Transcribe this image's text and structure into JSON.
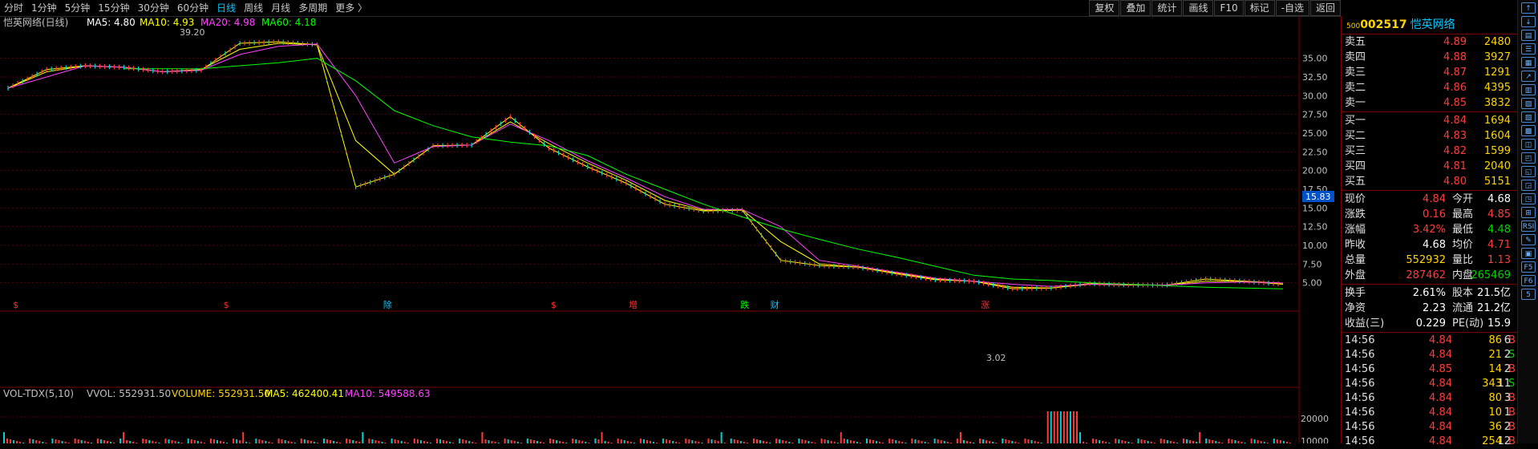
{
  "period_bar": {
    "items": [
      "分时",
      "1分钟",
      "5分钟",
      "15分钟",
      "30分钟",
      "60分钟",
      "日线",
      "周线",
      "月线",
      "多周期",
      "更多 〉"
    ],
    "active_index": 6
  },
  "toolbar": {
    "buttons": [
      "复权",
      "叠加",
      "统计",
      "画线",
      "F10",
      "标记",
      "-自选",
      "返回"
    ]
  },
  "main_legend": {
    "title": "恺英网络(日线)",
    "ma5": "MA5: 4.80",
    "ma10": "MA10: 4.93",
    "ma20": "MA20: 4.98",
    "ma60": "MA60: 4.18"
  },
  "main_axis": {
    "ticks": [
      "35.00",
      "32.50",
      "30.00",
      "27.50",
      "25.00",
      "22.50",
      "20.00",
      "17.50",
      "15.00",
      "12.50",
      "10.00",
      "7.50",
      "5.00"
    ],
    "tick_values": [
      35,
      32.5,
      30,
      27.5,
      25,
      22.5,
      20,
      17.5,
      15,
      12.5,
      10,
      7.5,
      5
    ],
    "crosshair_value": "15.83",
    "high_marker": "39.20",
    "low_marker": "3.02"
  },
  "event_markers": [
    {
      "label": "$",
      "color": "#ff3030",
      "pos": 0.01
    },
    {
      "label": "$",
      "color": "#ff3030",
      "pos": 0.172
    },
    {
      "label": "除",
      "color": "#00c8ff",
      "pos": 0.295
    },
    {
      "label": "$",
      "color": "#ff3030",
      "pos": 0.424
    },
    {
      "label": "增",
      "color": "#ff3030",
      "pos": 0.484
    },
    {
      "label": "跌",
      "color": "#00ff00",
      "pos": 0.57
    },
    {
      "label": "财",
      "color": "#00c8ff",
      "pos": 0.593
    },
    {
      "label": "涨",
      "color": "#ff3030",
      "pos": 0.755
    }
  ],
  "volume_legend": {
    "title": "VOL-TDX(5,10)",
    "vvol": "VVOL: 552931.50",
    "volume": "VOLUME: 552931.50",
    "ma5": "MA5: 462400.41",
    "ma10": "MA10: 549588.63"
  },
  "volume_axis": {
    "ticks": [
      "20000",
      "10000"
    ]
  },
  "quote": {
    "code": "002517",
    "name": "恺英网络",
    "code_prefix": "500",
    "asks": [
      {
        "label": "卖五",
        "price": "4.89",
        "vol": "2480"
      },
      {
        "label": "卖四",
        "price": "4.88",
        "vol": "3927"
      },
      {
        "label": "卖三",
        "price": "4.87",
        "vol": "1291"
      },
      {
        "label": "卖二",
        "price": "4.86",
        "vol": "4395"
      },
      {
        "label": "卖一",
        "price": "4.85",
        "vol": "3832"
      }
    ],
    "bids": [
      {
        "label": "买一",
        "price": "4.84",
        "vol": "1694"
      },
      {
        "label": "买二",
        "price": "4.83",
        "vol": "1604"
      },
      {
        "label": "买三",
        "price": "4.82",
        "vol": "1599"
      },
      {
        "label": "买四",
        "price": "4.81",
        "vol": "2040"
      },
      {
        "label": "买五",
        "price": "4.80",
        "vol": "5151"
      }
    ],
    "stats": [
      {
        "l1": "现价",
        "v1": "4.84",
        "c1": "red",
        "l2": "今开",
        "v2": "4.68",
        "c2": "white"
      },
      {
        "l1": "涨跌",
        "v1": "0.16",
        "c1": "red",
        "l2": "最高",
        "v2": "4.85",
        "c2": "red"
      },
      {
        "l1": "涨幅",
        "v1": "3.42%",
        "c1": "red",
        "l2": "最低",
        "v2": "4.48",
        "c2": "green"
      },
      {
        "l1": "昨收",
        "v1": "4.68",
        "c1": "white",
        "l2": "均价",
        "v2": "4.71",
        "c2": "red"
      },
      {
        "l1": "总量",
        "v1": "552932",
        "c1": "yellow",
        "l2": "量比",
        "v2": "1.13",
        "c2": "red"
      },
      {
        "l1": "外盘",
        "v1": "287462",
        "c1": "red",
        "l2": "内盘",
        "v2": "265469",
        "c2": "green"
      }
    ],
    "stats2": [
      {
        "l1": "换手",
        "v1": "2.61%",
        "c1": "white",
        "l2": "股本",
        "v2": "21.5亿",
        "c2": "white"
      },
      {
        "l1": "净资",
        "v1": "2.23",
        "c1": "white",
        "l2": "流通",
        "v2": "21.2亿",
        "c2": "white"
      },
      {
        "l1": "收益(三)",
        "v1": "0.229",
        "c1": "white",
        "l2": "PE(动)",
        "v2": "15.9",
        "c2": "white"
      }
    ],
    "ticks": [
      {
        "time": "14:56",
        "price": "4.84",
        "vol": "86",
        "bs": "B",
        "n": "6"
      },
      {
        "time": "14:56",
        "price": "4.84",
        "vol": "21",
        "bs": "S",
        "n": "2"
      },
      {
        "time": "14:56",
        "price": "4.85",
        "vol": "14",
        "bs": "B",
        "n": "2"
      },
      {
        "time": "14:56",
        "price": "4.84",
        "vol": "343",
        "bs": "S",
        "n": "11"
      },
      {
        "time": "14:56",
        "price": "4.84",
        "vol": "80",
        "bs": "B",
        "n": "3"
      },
      {
        "time": "14:56",
        "price": "4.84",
        "vol": "10",
        "bs": "B",
        "n": "1"
      },
      {
        "time": "14:56",
        "price": "4.84",
        "vol": "36",
        "bs": "B",
        "n": "2"
      },
      {
        "time": "14:56",
        "price": "4.84",
        "vol": "254",
        "bs": "B",
        "n": "12"
      }
    ]
  },
  "side_icons": [
    "↑",
    "↓",
    "▤",
    "☰",
    "▦",
    "↗",
    "▥",
    "▧",
    "▨",
    "▩",
    "◫",
    "◰",
    "◱",
    "◲",
    "◳",
    "⊞",
    "RSI",
    "✎",
    "▣",
    "F5",
    "F6",
    "5"
  ],
  "colors": {
    "up": "#ff3b3b",
    "down": "#00d2d2",
    "ma5": "#ffff00",
    "ma10": "#ff40ff",
    "ma20": "#00ff00",
    "grid": "#7a0000"
  },
  "chart_data": {
    "type": "line",
    "title": "恺英网络(日线)",
    "ylim": [
      2.5,
      40
    ],
    "series": [
      {
        "name": "MA5",
        "values": [
          31,
          33.5,
          34,
          33.8,
          33.2,
          33.4,
          37,
          37.2,
          36.8,
          17.8,
          19.5,
          23.3,
          23.4,
          27.2,
          23,
          20.5,
          18.3,
          15.5,
          14.6,
          14.7,
          8,
          7.3,
          7.1,
          6.2,
          5.4,
          5.2,
          4.2,
          4.3,
          4.9,
          4.7,
          4.7,
          5.5,
          5.2,
          4.8
        ]
      },
      {
        "name": "MA10",
        "values": [
          31,
          33.2,
          34,
          33.8,
          33.2,
          33.5,
          36.2,
          37,
          36.8,
          24,
          19.5,
          23.3,
          23.4,
          26.5,
          23.6,
          21,
          18.7,
          16,
          14.7,
          14.8,
          10.5,
          7.5,
          7.1,
          6.3,
          5.5,
          5.2,
          4.4,
          4.3,
          4.8,
          4.7,
          4.7,
          5.2,
          5.2,
          4.93
        ]
      },
      {
        "name": "MA20",
        "values": [
          31,
          32.5,
          34,
          33.8,
          33.2,
          33.4,
          35.5,
          36.6,
          36.9,
          30,
          21,
          23.2,
          23.4,
          26.2,
          24,
          21.3,
          19,
          16.5,
          14.8,
          14.8,
          12.5,
          8,
          7.2,
          6.4,
          5.6,
          5.2,
          4.8,
          4.5,
          4.8,
          4.75,
          4.7,
          5,
          5.1,
          4.98
        ]
      },
      {
        "name": "MA60",
        "values": [
          null,
          null,
          null,
          33.6,
          33.6,
          33.6,
          34,
          34.4,
          35,
          32,
          28,
          26,
          24.5,
          23.8,
          23.3,
          22,
          19.5,
          17.5,
          15.5,
          13.8,
          12.2,
          10.8,
          9.5,
          8.4,
          7.2,
          6,
          5.5,
          5.3,
          5,
          4.8,
          4.6,
          4.4,
          4.3,
          4.18
        ]
      }
    ]
  }
}
